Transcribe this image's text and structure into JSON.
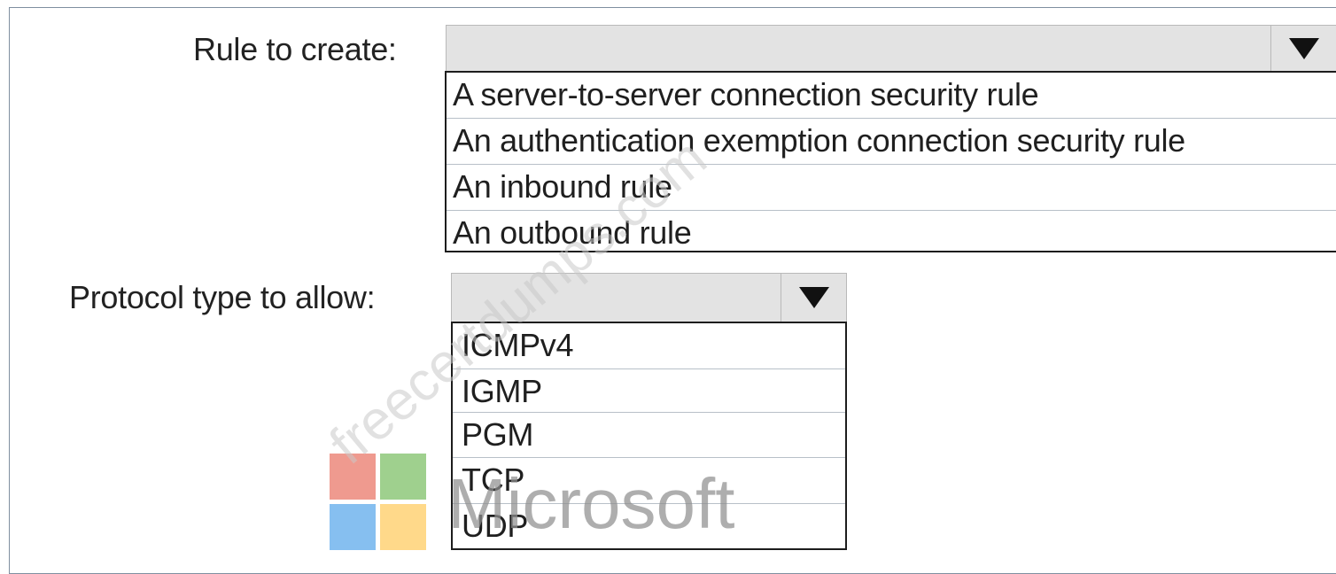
{
  "rule": {
    "label": "Rule to create:",
    "selected": "",
    "options": [
      "A server-to-server connection security rule",
      "An authentication exemption connection security rule",
      "An inbound rule",
      "An outbound rule"
    ]
  },
  "protocol": {
    "label": "Protocol type to allow:",
    "selected": "",
    "options": [
      "ICMPv4",
      "IGMP",
      "PGM",
      "TCP",
      "UDP"
    ]
  },
  "logo": {
    "wordmark": "Microsoft",
    "colors": [
      "#ef9a8f",
      "#9fd08e",
      "#86bff0",
      "#ffd98a"
    ]
  },
  "watermark": "freecertdumps.com",
  "dropdown_icon": "triangle-down-icon"
}
